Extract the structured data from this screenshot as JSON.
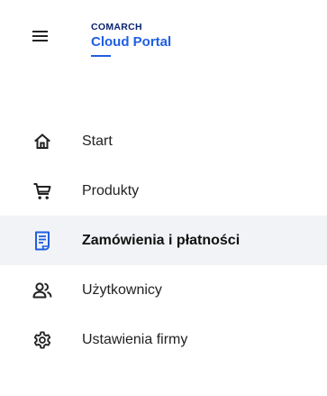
{
  "brand": {
    "company": "COMARCH",
    "product": "Cloud Portal"
  },
  "menu_button": {
    "icon": "hamburger-menu-icon"
  },
  "nav": {
    "items": [
      {
        "label": "Start",
        "icon": "home-icon",
        "active": false
      },
      {
        "label": "Produkty",
        "icon": "cart-icon",
        "active": false
      },
      {
        "label": "Zamówienia i płatności",
        "icon": "orders-icon",
        "active": true
      },
      {
        "label": "Użytkownicy",
        "icon": "users-icon",
        "active": false
      },
      {
        "label": "Ustawienia firmy",
        "icon": "gear-icon",
        "active": false
      }
    ]
  },
  "colors": {
    "brand_dark": "#0a2470",
    "brand_blue": "#1f5ee3",
    "active_bg": "#f2f3f6",
    "text": "#222222"
  }
}
